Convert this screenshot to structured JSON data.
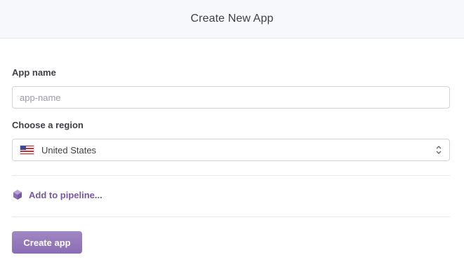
{
  "header": {
    "title": "Create New App"
  },
  "form": {
    "app_name": {
      "label": "App name",
      "placeholder": "app-name",
      "value": ""
    },
    "region": {
      "label": "Choose a region",
      "selected": "United States",
      "flag_icon": "us-flag-icon"
    },
    "pipeline": {
      "label": "Add to pipeline...",
      "icon": "pipeline-hexagon-icon"
    },
    "submit_label": "Create app"
  },
  "colors": {
    "header_bg": "#f7f8fb",
    "accent_purple": "#79589f",
    "button_gradient_top": "#a087c2",
    "button_gradient_bottom": "#8b6db5",
    "input_border": "#cfd3dc"
  }
}
